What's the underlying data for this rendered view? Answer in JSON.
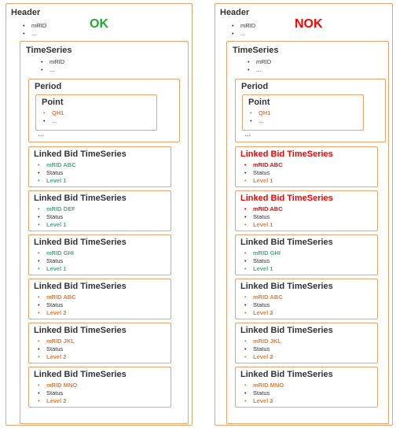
{
  "colors": {
    "box_border": "#e8a46c",
    "default": "#333333",
    "ok": "#22aa33",
    "nok": "#ff0000",
    "teal": "#4aaa90",
    "orange": "#ed7d31"
  },
  "panels": [
    {
      "status": "OK",
      "status_color": "#22aa33",
      "header": {
        "title": "Header",
        "items": [
          {
            "text": "mRID",
            "tone": "default"
          },
          {
            "text": "...",
            "tone": "default"
          }
        ]
      },
      "timeseries": {
        "title": "TimeSeries",
        "items": [
          {
            "text": "mRID",
            "tone": "default"
          },
          {
            "text": "...",
            "tone": "default"
          }
        ]
      },
      "period": {
        "title": "Period",
        "point": {
          "title": "Point",
          "items": [
            {
              "text": "QH1",
              "tone": "orange"
            },
            {
              "text": "...",
              "tone": "default"
            }
          ]
        },
        "ellipsis": "..."
      },
      "linked": [
        {
          "title": "Linked Bid TimeSeries",
          "title_tone": "default",
          "items": [
            {
              "text": "mRID ABC",
              "tone": "teal"
            },
            {
              "text": "Status",
              "tone": "default"
            },
            {
              "text": "Level 1",
              "tone": "teal"
            }
          ]
        },
        {
          "title": "Linked Bid TimeSeries",
          "title_tone": "default",
          "items": [
            {
              "text": "mRID DEF",
              "tone": "teal"
            },
            {
              "text": "Status",
              "tone": "default"
            },
            {
              "text": "Level 1",
              "tone": "teal"
            }
          ]
        },
        {
          "title": "Linked Bid TimeSeries",
          "title_tone": "default",
          "items": [
            {
              "text": "mRID GHI",
              "tone": "teal"
            },
            {
              "text": "Status",
              "tone": "default"
            },
            {
              "text": "Level 1",
              "tone": "teal"
            }
          ]
        },
        {
          "title": "Linked Bid TimeSeries",
          "title_tone": "default",
          "items": [
            {
              "text": "mRID ABC",
              "tone": "orange"
            },
            {
              "text": "Status",
              "tone": "default"
            },
            {
              "text": "Level 2",
              "tone": "orange"
            }
          ]
        },
        {
          "title": "Linked Bid TimeSeries",
          "title_tone": "default",
          "items": [
            {
              "text": "mRID JKL",
              "tone": "orange"
            },
            {
              "text": "Status",
              "tone": "default"
            },
            {
              "text": "Level 2",
              "tone": "orange"
            }
          ]
        },
        {
          "title": "Linked Bid TimeSeries",
          "title_tone": "default",
          "items": [
            {
              "text": "mRID MNO",
              "tone": "orange"
            },
            {
              "text": "Status",
              "tone": "default"
            },
            {
              "text": "Level 2",
              "tone": "orange"
            }
          ]
        }
      ]
    },
    {
      "status": "NOK",
      "status_color": "#ff0000",
      "header": {
        "title": "Header",
        "items": [
          {
            "text": "mRID",
            "tone": "default"
          },
          {
            "text": "...",
            "tone": "default"
          }
        ]
      },
      "timeseries": {
        "title": "TimeSeries",
        "items": [
          {
            "text": "mRID",
            "tone": "default"
          },
          {
            "text": "...",
            "tone": "default"
          }
        ]
      },
      "period": {
        "title": "Period",
        "point": {
          "title": "Point",
          "items": [
            {
              "text": "QH1",
              "tone": "orange"
            },
            {
              "text": "...",
              "tone": "default"
            }
          ]
        },
        "ellipsis": "..."
      },
      "linked": [
        {
          "title": "Linked Bid TimeSeries",
          "title_tone": "nok",
          "items": [
            {
              "text": "mRID ABC",
              "tone": "nok"
            },
            {
              "text": "Status",
              "tone": "default"
            },
            {
              "text": "Level 1",
              "tone": "orange"
            }
          ]
        },
        {
          "title": "Linked Bid TimeSeries",
          "title_tone": "nok",
          "items": [
            {
              "text": "mRID ABC",
              "tone": "nok"
            },
            {
              "text": "Status",
              "tone": "default"
            },
            {
              "text": "Level 1",
              "tone": "orange"
            }
          ]
        },
        {
          "title": "Linked Bid TimeSeries",
          "title_tone": "default",
          "items": [
            {
              "text": "mRID GHI",
              "tone": "teal"
            },
            {
              "text": "Status",
              "tone": "default"
            },
            {
              "text": "Level 1",
              "tone": "teal"
            }
          ]
        },
        {
          "title": "Linked Bid TimeSeries",
          "title_tone": "default",
          "items": [
            {
              "text": "mRID ABC",
              "tone": "orange"
            },
            {
              "text": "Status",
              "tone": "default"
            },
            {
              "text": "Level 2",
              "tone": "orange"
            }
          ]
        },
        {
          "title": "Linked Bid TimeSeries",
          "title_tone": "default",
          "items": [
            {
              "text": "mRID JKL",
              "tone": "orange"
            },
            {
              "text": "Status",
              "tone": "default"
            },
            {
              "text": "Level 2",
              "tone": "orange"
            }
          ]
        },
        {
          "title": "Linked Bid TimeSeries",
          "title_tone": "default",
          "items": [
            {
              "text": "mRID MNO",
              "tone": "orange"
            },
            {
              "text": "Status",
              "tone": "default"
            },
            {
              "text": "Level 2",
              "tone": "orange"
            }
          ]
        }
      ]
    }
  ]
}
